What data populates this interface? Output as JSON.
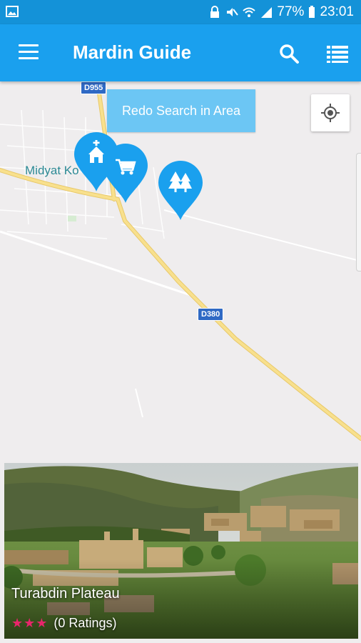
{
  "status_bar": {
    "battery": "77%",
    "time": "23:01"
  },
  "app_bar": {
    "title": "Mardin Guide"
  },
  "map": {
    "redo_button_label": "Redo Search in Area",
    "road_labels": [
      "D955",
      "D380"
    ],
    "town_label": "Midyat Ko",
    "pins": [
      {
        "icon": "church-icon"
      },
      {
        "icon": "cart-icon"
      },
      {
        "icon": "tree-icon"
      }
    ]
  },
  "card": {
    "title": "Turabdin Plateau",
    "stars": "★★★",
    "ratings_text": "(0 Ratings)"
  },
  "colors": {
    "primary": "#1aa0ee",
    "status_bar": "#1492d8",
    "redo_button": "#6cc6f4",
    "star": "#e8256b",
    "road": "#f6dc7a"
  }
}
